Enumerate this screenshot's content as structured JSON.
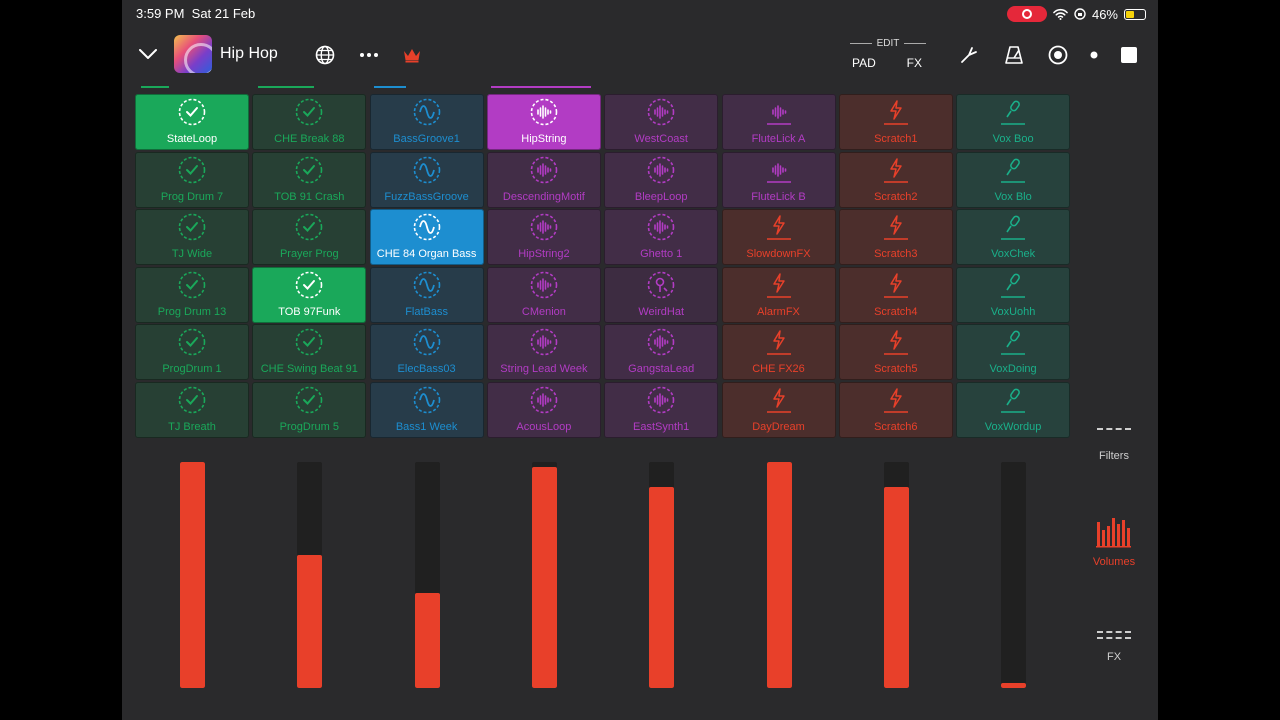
{
  "status_bar": {
    "time": "3:59 PM",
    "date": "Sat 21 Feb",
    "battery": "46%"
  },
  "header": {
    "title": "Hip Hop",
    "edit_label": "EDIT",
    "pad_label": "PAD",
    "fx_label": "FX"
  },
  "columns": [
    {
      "color": "#1aa85a",
      "icon": "loop-check-icon",
      "cells": [
        {
          "label": "StateLoop",
          "active": true
        },
        {
          "label": "Prog Drum 7"
        },
        {
          "label": "TJ Wide"
        },
        {
          "label": "Prog Drum 13"
        },
        {
          "label": "ProgDrum 1"
        },
        {
          "label": "TJ Breath"
        }
      ]
    },
    {
      "color": "#1aa85a",
      "icon": "loop-check-icon",
      "cells": [
        {
          "label": "CHE Break 88"
        },
        {
          "label": "TOB 91 Crash"
        },
        {
          "label": "Prayer Prog"
        },
        {
          "label": "TOB 97Funk",
          "active": true
        },
        {
          "label": "CHE Swing Beat 91"
        },
        {
          "label": "ProgDrum 5"
        }
      ]
    },
    {
      "color": "#1d8ed0",
      "icon": "sine-wave-icon",
      "cells": [
        {
          "label": "BassGroove1"
        },
        {
          "label": "FuzzBassGroove"
        },
        {
          "label": "CHE 84 Organ Bass",
          "active": true
        },
        {
          "label": "FlatBass"
        },
        {
          "label": "ElecBass03"
        },
        {
          "label": "Bass1 Week"
        }
      ]
    },
    {
      "color": "#b23cc4",
      "icon": "waveform-icon",
      "cells": [
        {
          "label": "HipString",
          "active": true
        },
        {
          "label": "DescendingMotif"
        },
        {
          "label": "HipString2"
        },
        {
          "label": "CMenion"
        },
        {
          "label": "String Lead Week"
        },
        {
          "label": "AcousLoop"
        }
      ]
    },
    {
      "color": "#b23cc4",
      "icon": "waveform-icon",
      "cells": [
        {
          "label": "WestCoast"
        },
        {
          "label": "BleepLoop"
        },
        {
          "label": "Ghetto 1"
        },
        {
          "label": "WeirdHat",
          "alt": true
        },
        {
          "label": "GangstaLead"
        },
        {
          "label": "EastSynth1"
        }
      ]
    },
    {
      "color": "#b23cc4",
      "icon": "waveform-icon",
      "cells": [
        {
          "label": "FluteLick A"
        },
        {
          "label": "FluteLick B"
        },
        {
          "label": "SlowdownFX",
          "fx": true
        },
        {
          "label": "AlarmFX",
          "fx": true
        },
        {
          "label": "CHE FX26",
          "fx": true
        },
        {
          "label": "DayDream",
          "fx": true
        }
      ]
    },
    {
      "color": "#e8402a",
      "icon": "lightning-icon",
      "cells": [
        {
          "label": "Scratch1"
        },
        {
          "label": "Scratch2"
        },
        {
          "label": "Scratch3"
        },
        {
          "label": "Scratch4"
        },
        {
          "label": "Scratch5"
        },
        {
          "label": "Scratch6"
        }
      ]
    },
    {
      "color": "#1ab08a",
      "icon": "microphone-icon",
      "cells": [
        {
          "label": "Vox Boo"
        },
        {
          "label": "Vox Blo"
        },
        {
          "label": "VoxChek"
        },
        {
          "label": "VoxUohh"
        },
        {
          "label": "VoxDoing"
        },
        {
          "label": "VoxWordup"
        }
      ]
    }
  ],
  "volumes": [
    1.0,
    0.59,
    0.42,
    0.98,
    0.89,
    1.0,
    0.89,
    0.02
  ],
  "side_panel": {
    "filters": "Filters",
    "volumes": "Volumes",
    "fx": "FX"
  }
}
